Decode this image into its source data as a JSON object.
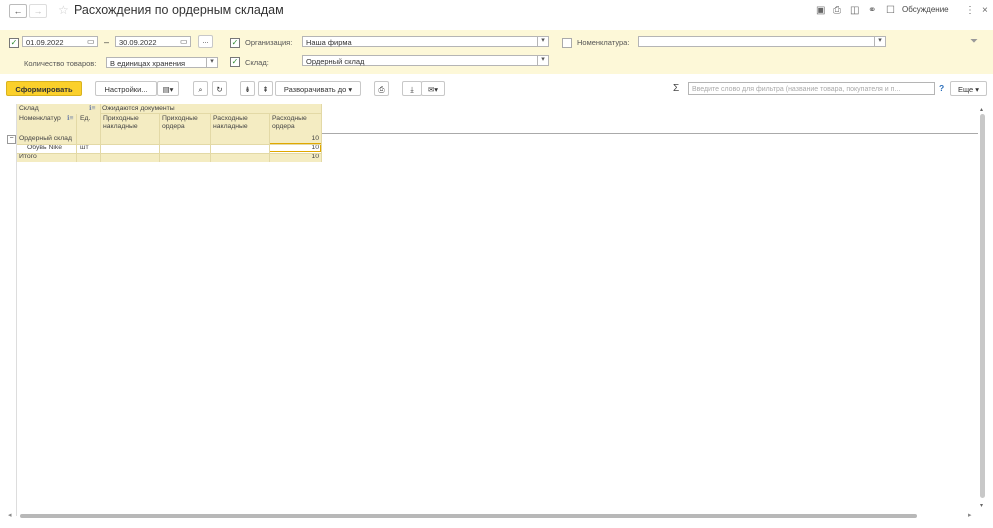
{
  "title": "Расхождения по ордерным складам",
  "header_actions": {
    "discussion": "Обсуждение"
  },
  "filters": {
    "date_from": "01.09.2022",
    "dash": "–",
    "date_to": "30.09.2022",
    "ellipsis": "...",
    "org_label": "Организация:",
    "org_value": "Наша фирма",
    "nom_label": "Номенклатура:",
    "nom_value": "",
    "qty_label": "Количество товаров:",
    "qty_value": "В единицах хранения",
    "warehouse_label": "Склад:",
    "warehouse_value": "Ордерный склад"
  },
  "toolbar": {
    "generate": "Сформировать",
    "settings": "Настройки...",
    "expand_to": "Разворачивать до",
    "search_placeholder": "Введите слово для фильтра (название товара, покупателя и п...",
    "help": "?",
    "more": "Еще"
  },
  "report": {
    "header_row1": {
      "col1": "Склад",
      "expected": "Ожидаются документы"
    },
    "header_row2": {
      "col1": "Номенклатур",
      "unit": "Ед.",
      "incoming_invoices": "Приходные накладные",
      "incoming_orders": "Приходные ордера",
      "outgoing_invoices": "Расходные накладные",
      "outgoing_orders": "Расходные ордера"
    },
    "rows": [
      {
        "name": "Ордерный склад",
        "unit": "",
        "outgoing_orders": "10"
      },
      {
        "name": "Обувь Nike",
        "unit": "шт",
        "outgoing_orders": "10"
      }
    ],
    "total": {
      "name": "Итого",
      "outgoing_orders": "10"
    }
  }
}
